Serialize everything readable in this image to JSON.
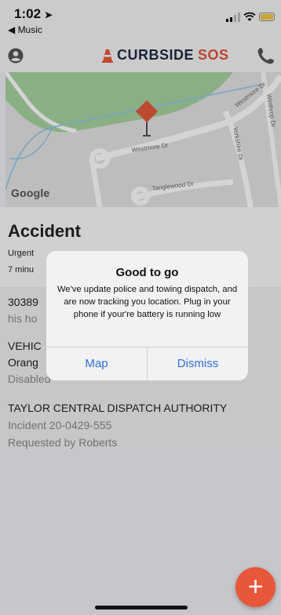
{
  "status_bar": {
    "time": "1:02",
    "back_app": "◀ Music"
  },
  "nav": {
    "brand_main": "CURBSIDE",
    "brand_accent": "SOS"
  },
  "map": {
    "google_label": "Google",
    "streets": [
      "Westmore Dr",
      "Westmore Dr",
      "Winthrop Dr",
      "Yorkshire Dr",
      "Tanglewood Dr"
    ]
  },
  "incident": {
    "title": "Accident",
    "line1": "Urgent",
    "line2": "7 minu",
    "address_line": "30389",
    "address_sub": "his ho",
    "vehicle_label": "VEHIC",
    "vehicle_color": "Orang",
    "vehicle_status": "Disabled",
    "authority": "TAYLOR CENTRAL DISPATCH AUTHORITY",
    "incident_number": "Incident 20-0429-555",
    "requested_by": "Requested by Roberts"
  },
  "dialog": {
    "title": "Good to go",
    "message": "We've update police and towing dispatch, and are now tracking you location. Plug in your phone if your're battery is running low",
    "map_button": "Map",
    "dismiss_button": "Dismiss"
  },
  "fab": {
    "label": "+"
  },
  "colors": {
    "accent": "#e8573a",
    "link": "#2d6fd6",
    "brand_dark": "#1f2a44"
  }
}
